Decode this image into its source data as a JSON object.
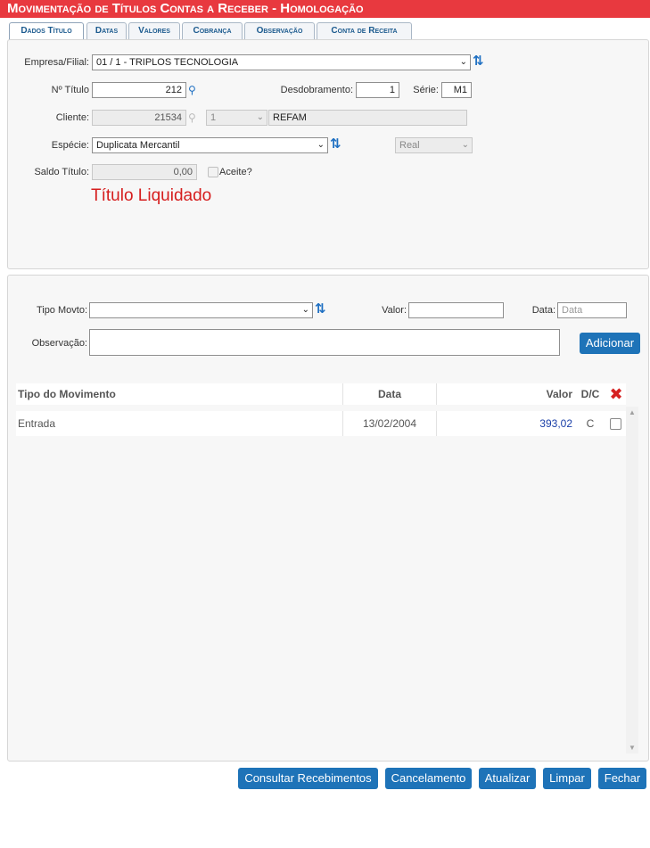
{
  "window": {
    "title": "Movimentação de Títulos Contas a Receber  - Homologação"
  },
  "tabs": [
    {
      "label": "Dados Título"
    },
    {
      "label": "Datas"
    },
    {
      "label": "Valores"
    },
    {
      "label": "Cobrança"
    },
    {
      "label": "Observação"
    },
    {
      "label": "Conta de Receita"
    }
  ],
  "form": {
    "empresa_label": "Empresa/Filial:",
    "empresa_value": "01 / 1 - TRIPLOS TECNOLOGIA",
    "titulo_label": "Nº Título",
    "titulo_value": "212",
    "desdobramento_label": "Desdobramento:",
    "desdobramento_value": "1",
    "serie_label": "Série:",
    "serie_value": "M1",
    "cliente_label": "Cliente:",
    "cliente_code": "21534",
    "cliente_seq": "1",
    "cliente_name": "REFAM",
    "especie_label": "Espécie:",
    "especie_value": "Duplicata Mercantil",
    "moeda_value": "Real",
    "saldo_label": "Saldo Título:",
    "saldo_value": "0,00",
    "aceite_label": "Aceite?",
    "status_text": "Título Liquidado"
  },
  "movto": {
    "tipo_label": "Tipo Movto:",
    "tipo_value": "",
    "valor_label": "Valor:",
    "valor_value": "",
    "data_label": "Data:",
    "data_placeholder": "Data",
    "obs_label": "Observação:",
    "obs_value": "",
    "add_button": "Adicionar"
  },
  "table": {
    "headers": {
      "tipo": "Tipo do Movimento",
      "data": "Data",
      "valor": "Valor",
      "dc": "D/C"
    },
    "rows": [
      {
        "tipo": "Entrada",
        "data": "13/02/2004",
        "valor": "393,02",
        "dc": "C"
      }
    ]
  },
  "actions": {
    "consultar": "Consultar Recebimentos",
    "cancelamento": "Cancelamento",
    "atualizar": "Atualizar",
    "limpar": "Limpar",
    "fechar": "Fechar"
  },
  "colors": {
    "title_bar": "#e8393f",
    "accent": "#1e73b8",
    "status_red": "#d61e1e",
    "value_blue": "#1a3fa8",
    "delete_red": "#d62222"
  },
  "icons": {
    "refresh": "refresh-icon",
    "search": "search-icon",
    "delete": "delete-x-icon"
  }
}
